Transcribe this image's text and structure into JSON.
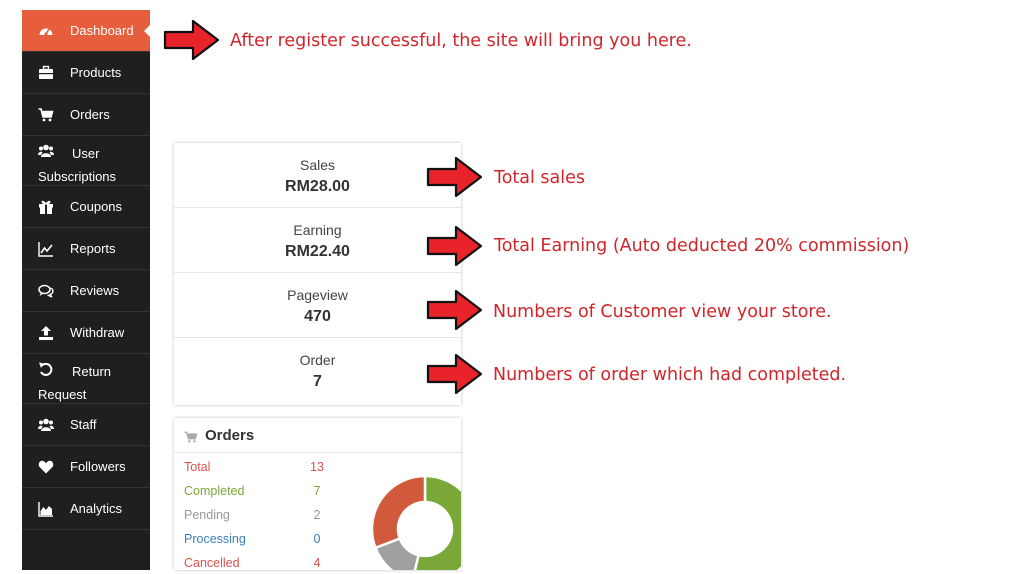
{
  "sidebar": {
    "items": [
      {
        "label": "Dashboard",
        "icon": "dashboard-icon",
        "active": true
      },
      {
        "label": "Products",
        "icon": "briefcase-icon"
      },
      {
        "label": "Orders",
        "icon": "cart-icon"
      },
      {
        "label": "User Subscriptions",
        "icon": "users-icon"
      },
      {
        "label": "Coupons",
        "icon": "gift-icon"
      },
      {
        "label": "Reports",
        "icon": "line-chart-icon"
      },
      {
        "label": "Reviews",
        "icon": "comments-icon"
      },
      {
        "label": "Withdraw",
        "icon": "upload-icon"
      },
      {
        "label": "Return Request",
        "icon": "undo-icon"
      },
      {
        "label": "Staff",
        "icon": "users-icon"
      },
      {
        "label": "Followers",
        "icon": "heart-icon"
      },
      {
        "label": "Analytics",
        "icon": "area-chart-icon"
      }
    ]
  },
  "stats": [
    {
      "label": "Sales",
      "value": "RM28.00"
    },
    {
      "label": "Earning",
      "value": "RM22.40"
    },
    {
      "label": "Pageview",
      "value": "470"
    },
    {
      "label": "Order",
      "value": "7"
    }
  ],
  "orders": {
    "title": "Orders",
    "rows": [
      {
        "label": "Total",
        "count": "13",
        "color": "#d9534f"
      },
      {
        "label": "Completed",
        "count": "7",
        "color": "#7aa838"
      },
      {
        "label": "Pending",
        "count": "2",
        "color": "#999999"
      },
      {
        "label": "Processing",
        "count": "0",
        "color": "#3a7eb8"
      },
      {
        "label": "Cancelled",
        "count": "4",
        "color": "#d9534f"
      }
    ],
    "chart_data": {
      "type": "pie",
      "categories": [
        "Completed",
        "Pending",
        "Processing",
        "Cancelled"
      ],
      "values": [
        7,
        2,
        0,
        4
      ],
      "colors": [
        "#7aa838",
        "#a0a0a0",
        "#3a7eb8",
        "#d15a3c"
      ]
    }
  },
  "annotations": {
    "dashboard": "After register successful, the site will bring you here.",
    "sales": "Total sales",
    "earning": "Total Earning (Auto deducted 20% commission)",
    "pageview": "Numbers of Customer view your store.",
    "order": "Numbers of order which had completed."
  },
  "colors": {
    "sidebar_bg": "#1f1f1f",
    "accent": "#e65e3c",
    "annotation": "#d0252a",
    "arrow_fill": "#e8232a"
  }
}
